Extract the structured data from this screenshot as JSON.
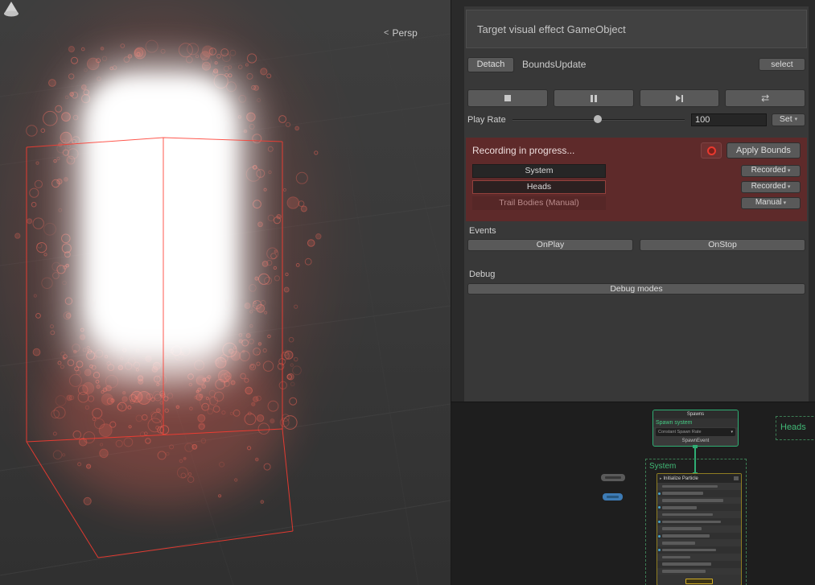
{
  "scene": {
    "persp_label": "Persp",
    "persp_arrow": "<"
  },
  "panel": {
    "title": "Target visual effect GameObject",
    "attach": {
      "detach": "Detach",
      "target": "BoundsUpdate",
      "select": "select"
    },
    "play_rate": {
      "label": "Play Rate",
      "value": "100",
      "set": "Set"
    },
    "recording": {
      "status": "Recording in progress...",
      "apply_bounds": "Apply Bounds",
      "rows": [
        {
          "name": "System",
          "mode": "Recorded"
        },
        {
          "name": "Heads",
          "mode": "Recorded"
        },
        {
          "name": "Trail Bodies (Manual)",
          "mode": "Manual"
        }
      ]
    },
    "events": {
      "label": "Events",
      "onplay": "OnPlay",
      "onstop": "OnStop"
    },
    "debug": {
      "label": "Debug",
      "modes": "Debug modes"
    }
  },
  "graph": {
    "spawn": {
      "title": "Spawns",
      "system_label": "Spawn system",
      "field": "Constant Spawn Rate",
      "footer": "SpawnEvent"
    },
    "system_container": "System",
    "heads_container": "Heads",
    "init": {
      "title": "Initialize Particle"
    }
  },
  "icons": {
    "caret": "▾",
    "loop": "⇄",
    "node_caret": "▸"
  },
  "colors": {
    "wireframe_red": "#ff3b30",
    "recording_bg": "#5e2a2a",
    "record_red": "#e8392f",
    "node_green": "#2fae74",
    "init_yellow": "#8f7d22",
    "panel_bg": "#383838"
  }
}
